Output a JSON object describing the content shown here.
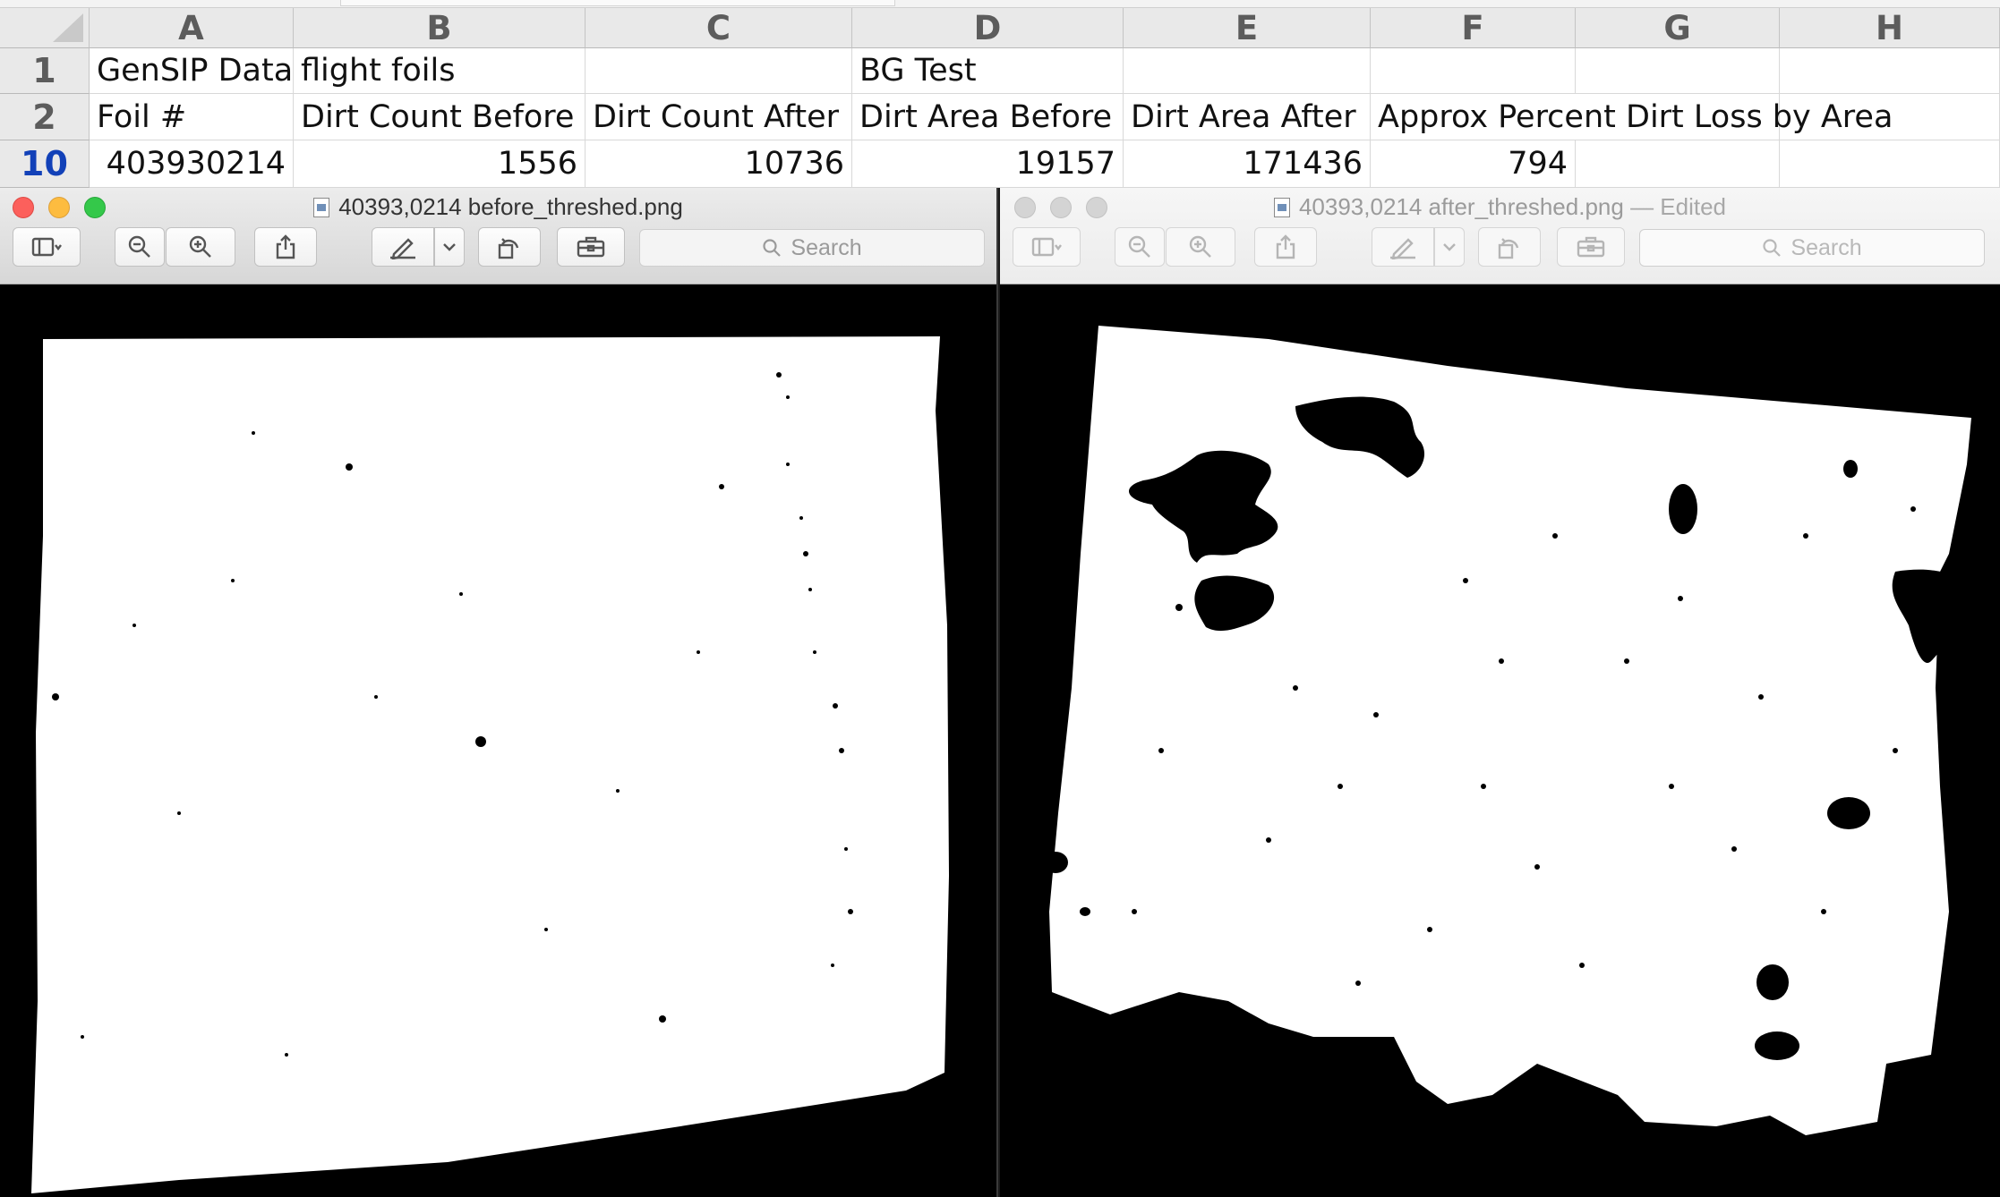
{
  "spreadsheet": {
    "columns": [
      "A",
      "B",
      "C",
      "D",
      "E",
      "F",
      "G",
      "H"
    ],
    "rows": [
      {
        "header": "1",
        "selected": false,
        "cells": [
          "GenSIP Data",
          "flight foils",
          "",
          "BG Test",
          "",
          "",
          "",
          ""
        ]
      },
      {
        "header": "2",
        "selected": false,
        "cells": [
          "Foil #",
          "Dirt Count Before",
          "Dirt Count After",
          "Dirt Area Before",
          "Dirt Area After",
          "Approx Percent Dirt Loss by Area",
          "",
          ""
        ]
      },
      {
        "header": "10",
        "selected": true,
        "cells": [
          "403930214",
          "1556",
          "10736",
          "19157",
          "171436",
          "794",
          "",
          ""
        ]
      }
    ]
  },
  "windows": [
    {
      "title": "40393,0214 before_threshed.png",
      "edited_suffix": "",
      "active": true,
      "search_placeholder": "Search"
    },
    {
      "title": "40393,0214 after_threshed.png",
      "edited_suffix": "— Edited",
      "active": false,
      "search_placeholder": "Search"
    }
  ],
  "toolbar_icons": [
    "sidebar-icon",
    "chevron-down-icon",
    "zoom-out-icon",
    "zoom-in-icon",
    "share-icon",
    "markup-pen-icon",
    "chevron-down-icon",
    "rotate-icon",
    "toolbox-icon",
    "search-icon"
  ],
  "colors": {
    "close": "#fc605c",
    "minimize": "#fdbc40",
    "maximize": "#34c84a",
    "selected_row_header": "#1241b8"
  }
}
